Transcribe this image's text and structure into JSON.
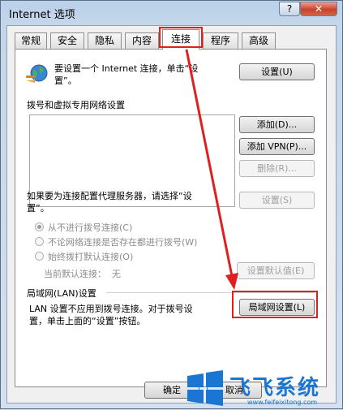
{
  "window": {
    "title": "Internet 选项",
    "help_label": "?",
    "close_label": "✕"
  },
  "tabs": [
    {
      "label": "常规"
    },
    {
      "label": "安全"
    },
    {
      "label": "隐私"
    },
    {
      "label": "内容"
    },
    {
      "label": "连接"
    },
    {
      "label": "程序"
    },
    {
      "label": "高级"
    }
  ],
  "active_tab": "连接",
  "setup": {
    "text_line1": "要设置一个 Internet 连接，单击“设",
    "text_line2": "置”。",
    "button": "设置(U)"
  },
  "dialup": {
    "heading": "拨号和虚拟专用网络设置",
    "add_button": "添加(D)...",
    "add_vpn_button": "添加 VPN(P)...",
    "delete_button": "删除(R)...",
    "settings_button": "设置(S)",
    "proxy_text_line1": "如果要为连接配置代理服务器，请选择“设",
    "proxy_text_line2": "置”。",
    "options": [
      {
        "label": "从不进行拨号连接(C)",
        "checked": true
      },
      {
        "label": "不论网络连接是否存在都进行拨号(W)",
        "checked": false
      },
      {
        "label": "始终拨打默认连接(O)",
        "checked": false
      }
    ],
    "current_default_label": "当前默认连接：",
    "current_default_value": "无",
    "set_default_button": "设置默认值(E)"
  },
  "lan": {
    "heading": "局域网(LAN)设置",
    "text_line1": "LAN 设置不应用到拨号连接。对于拨号设",
    "text_line2": "置，单击上面的“设置”按钮。",
    "button": "局域网设置(L)"
  },
  "footer": {
    "ok_button": "确定",
    "cancel_button": "取消"
  },
  "watermark": {
    "brand": "飞飞系统",
    "url": "www.feifeixitong.com"
  },
  "colors": {
    "highlight": "#e02020",
    "watermark_blue": "#1a76d2"
  }
}
